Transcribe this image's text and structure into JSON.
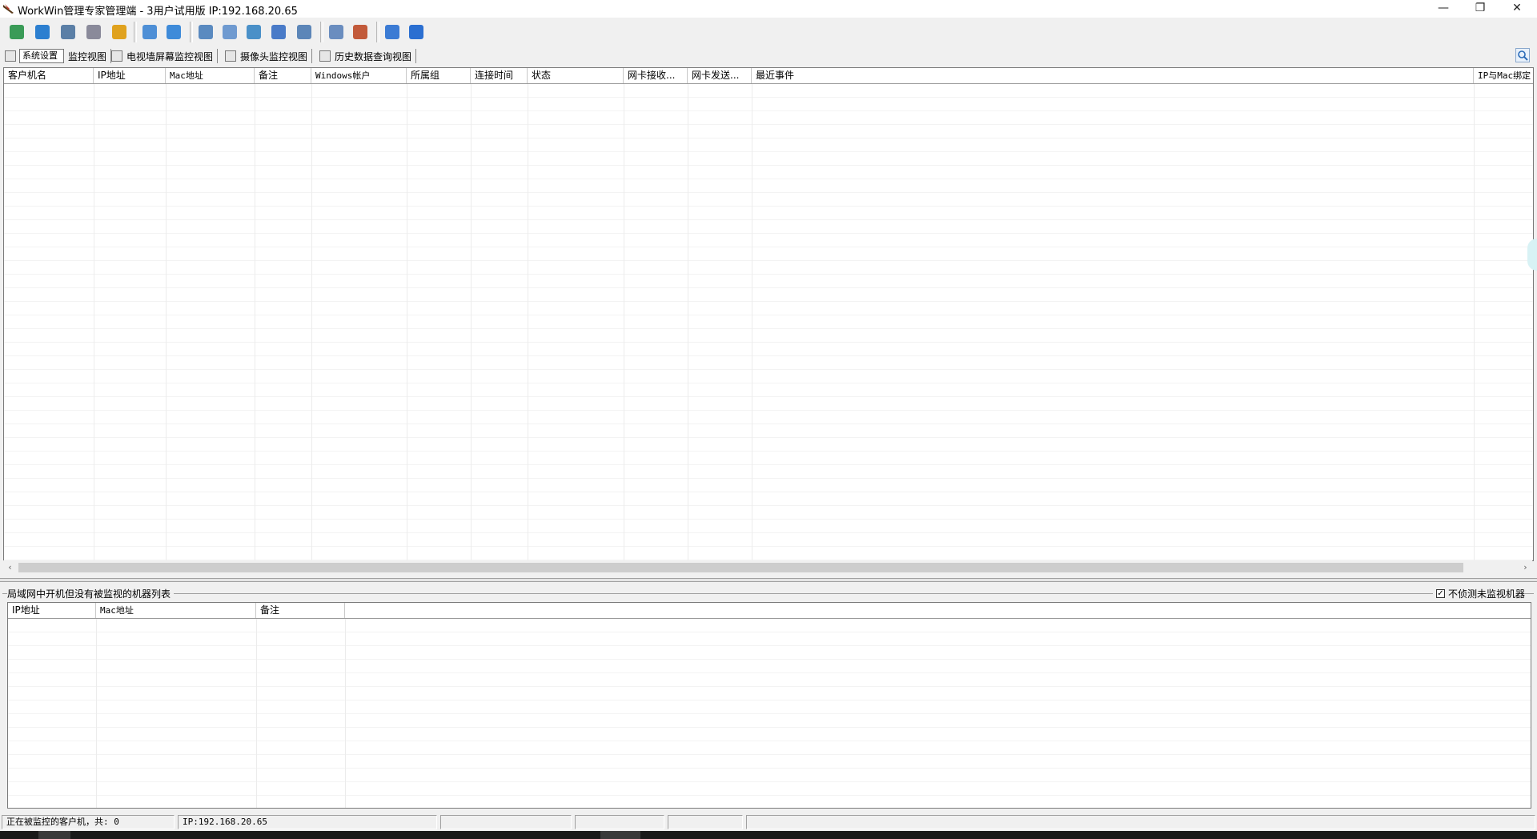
{
  "window": {
    "title": "WorkWin管理专家管理端 - 3用户试用版 IP:192.168.20.65",
    "controls": {
      "minimize": "—",
      "restore": "❐",
      "close": "✕"
    }
  },
  "toolbar": {
    "buttons": [
      {
        "icon": "database-icon",
        "color": "#3a9b57"
      },
      {
        "icon": "globe-icon",
        "color": "#2c7fd0"
      },
      {
        "icon": "screen-gear-icon",
        "color": "#5b7fa6"
      },
      {
        "icon": "user-mail-icon",
        "color": "#8a8a9a"
      },
      {
        "icon": "users-group-icon",
        "color": "#e0a21e"
      },
      {
        "icon": "usb-transfer-icon",
        "color": "#4e8fd6"
      },
      {
        "icon": "usb-drive-icon",
        "color": "#3f8bd9"
      },
      {
        "icon": "monitor-icon",
        "color": "#5a8ac0"
      },
      {
        "icon": "remote-control-icon",
        "color": "#6f9ad0"
      },
      {
        "icon": "document-search-icon",
        "color": "#4a90c8"
      },
      {
        "icon": "multi-screen-icon",
        "color": "#4a7bc8"
      },
      {
        "icon": "disc-icon",
        "color": "#5c86b8"
      },
      {
        "icon": "report-icon",
        "color": "#6a8dbf"
      },
      {
        "icon": "policy-icon",
        "color": "#c25a3a"
      },
      {
        "icon": "keyboard-icon",
        "color": "#3b7bd4"
      },
      {
        "icon": "help-icon",
        "color": "#2b6fd1"
      }
    ],
    "tooltip": "系统设置"
  },
  "tabs": [
    {
      "label": "监控视图"
    },
    {
      "label": "电视墙屏幕监控视图"
    },
    {
      "label": "摄像头监控视图"
    },
    {
      "label": "历史数据查询视图"
    }
  ],
  "main_table": {
    "columns": [
      "客户机名",
      "IP地址",
      "Mac地址",
      "备注",
      "Windows帐户",
      "所属组",
      "连接时间",
      "状态",
      "网卡接收...",
      "网卡发送...",
      "最近事件",
      "IP与Mac绑定"
    ],
    "rows": []
  },
  "scroll": {
    "left": "‹",
    "right": "›"
  },
  "lan_section": {
    "label": "局域网中开机但没有被监视的机器列表",
    "option_label": "不侦测未监视机器",
    "option_checked": true,
    "check_mark": "✓",
    "columns": [
      "IP地址",
      "Mac地址",
      "备注"
    ],
    "rows": []
  },
  "statusbar": {
    "monitored": "正在被监控的客户机，共: 0",
    "ip": "IP:192.168.20.65"
  }
}
